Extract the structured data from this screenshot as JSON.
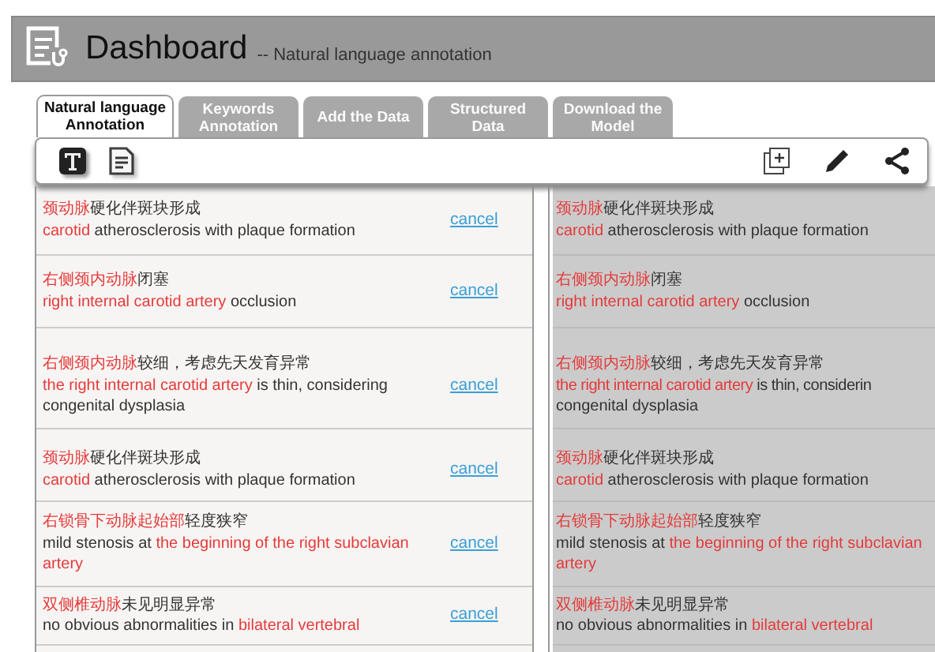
{
  "header": {
    "title": "Dashboard",
    "subtitle": "-- Natural language annotation"
  },
  "tabs": [
    {
      "label": "Natural language Annotation",
      "selected": true
    },
    {
      "label": "Keywords Annotation",
      "selected": false
    },
    {
      "label": "Add the Data",
      "selected": false
    },
    {
      "label": "Structured Data",
      "selected": false
    },
    {
      "label": "Download the Model",
      "selected": false
    }
  ],
  "toolbar": {
    "left": [
      {
        "kind": "text-tool",
        "selected": true
      },
      {
        "kind": "document",
        "selected": false
      }
    ],
    "right": [
      {
        "kind": "add"
      },
      {
        "kind": "edit"
      },
      {
        "kind": "share"
      }
    ]
  },
  "annotations": [
    {
      "zh": [
        {
          "text": "颈动脉",
          "highlight": true
        },
        {
          "text": "硬化伴斑块形成",
          "highlight": false
        }
      ],
      "en": [
        {
          "text": "carotid",
          "highlight": true
        },
        {
          "text": " atherosclerosis with plaque formation",
          "highlight": false
        }
      ],
      "action": "cancel"
    },
    {
      "zh": [
        {
          "text": "右侧颈内动脉",
          "highlight": true
        },
        {
          "text": "闭塞",
          "highlight": false
        }
      ],
      "en": [
        {
          "text": "right internal carotid artery",
          "highlight": true
        },
        {
          "text": " occlusion",
          "highlight": false
        }
      ],
      "action": "cancel"
    },
    {
      "zh": [
        {
          "text": "右侧颈内动脉",
          "highlight": true
        },
        {
          "text": "较细，考虑先天发育异常",
          "highlight": false
        }
      ],
      "en": [
        {
          "text": "the right internal carotid artery",
          "highlight": true
        },
        {
          "text": " is thin, considering congenital dysplasia",
          "highlight": false
        }
      ],
      "action": "cancel"
    },
    {
      "zh": [
        {
          "text": "颈动脉",
          "highlight": true
        },
        {
          "text": "硬化伴斑块形成",
          "highlight": false
        }
      ],
      "en": [
        {
          "text": "carotid",
          "highlight": true
        },
        {
          "text": " atherosclerosis with plaque formation",
          "highlight": false
        }
      ],
      "action": "cancel"
    },
    {
      "zh": [
        {
          "text": "右锁骨下动脉起始部",
          "highlight": true
        },
        {
          "text": "轻度狭窄",
          "highlight": false
        }
      ],
      "en": [
        {
          "text": "mild stenosis at ",
          "highlight": false
        },
        {
          "text": "the beginning of the right subclavian artery",
          "highlight": true
        }
      ],
      "action": "cancel"
    },
    {
      "zh": [
        {
          "text": "双侧椎动脉",
          "highlight": true
        },
        {
          "text": "未见明显异常",
          "highlight": false
        }
      ],
      "en": [
        {
          "text": "no obvious abnormalities in ",
          "highlight": false
        },
        {
          "text": "bilateral vertebral",
          "highlight": true
        }
      ],
      "action": "cancel"
    }
  ],
  "preview": [
    {
      "zh": [
        {
          "text": "颈动脉",
          "highlight": true
        },
        {
          "text": "硬化伴斑块形成",
          "highlight": false
        }
      ],
      "en": [
        {
          "text": "carotid",
          "highlight": true
        },
        {
          "text": " atherosclerosis with plaque formation",
          "highlight": false
        }
      ]
    },
    {
      "zh": [
        {
          "text": "右侧颈内动脉",
          "highlight": true
        },
        {
          "text": "闭塞",
          "highlight": false
        }
      ],
      "en": [
        {
          "text": "right internal carotid artery",
          "highlight": true
        },
        {
          "text": " occlusion",
          "highlight": false
        }
      ]
    },
    {
      "zh": [
        {
          "text": "右侧颈内动脉",
          "highlight": true
        },
        {
          "text": "较细，考虑先天发育异常",
          "highlight": false
        }
      ],
      "en": [
        {
          "text": "the right internal carotid artery",
          "highlight": true
        },
        {
          "text": " is thin, considerin",
          "highlight": false
        }
      ],
      "en2": "congenital dysplasia"
    },
    {
      "zh": [
        {
          "text": "颈动脉",
          "highlight": true
        },
        {
          "text": "硬化伴斑块形成",
          "highlight": false
        }
      ],
      "en": [
        {
          "text": "carotid",
          "highlight": true
        },
        {
          "text": " atherosclerosis with plaque formation",
          "highlight": false
        }
      ]
    },
    {
      "zh": [
        {
          "text": "右锁骨下动脉起始部",
          "highlight": true
        },
        {
          "text": "轻度狭窄",
          "highlight": false
        }
      ],
      "en": [
        {
          "text": "mild stenosis at ",
          "highlight": false
        },
        {
          "text": "the beginning of the right subclavian artery",
          "highlight": true
        }
      ]
    },
    {
      "zh": [
        {
          "text": "双侧椎动脉",
          "highlight": true
        },
        {
          "text": "未见明显异常",
          "highlight": false
        }
      ],
      "en": [
        {
          "text": "no obvious abnormalities in ",
          "highlight": false
        },
        {
          "text": "bilateral vertebral",
          "highlight": true
        }
      ]
    }
  ]
}
